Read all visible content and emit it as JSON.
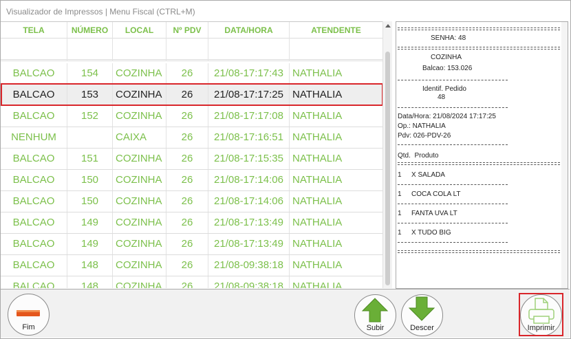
{
  "window": {
    "title": "Visualizador de Impressos | Menu Fiscal (CTRL+M)"
  },
  "grid": {
    "columns": [
      "TELA",
      "NÚMERO",
      "LOCAL",
      "Nº PDV",
      "DATA/HORA",
      "ATENDENTE"
    ],
    "rows": [
      [
        "BALCAO",
        "154",
        "COZINHA",
        "26",
        "21/08-17:17:43",
        "NATHALIA"
      ],
      [
        "BALCAO",
        "153",
        "COZINHA",
        "26",
        "21/08-17:17:25",
        "NATHALIA"
      ],
      [
        "BALCAO",
        "152",
        "COZINHA",
        "26",
        "21/08-17:17:08",
        "NATHALIA"
      ],
      [
        "NENHUM",
        "",
        "CAIXA",
        "26",
        "21/08-17:16:51",
        "NATHALIA"
      ],
      [
        "BALCAO",
        "151",
        "COZINHA",
        "26",
        "21/08-17:15:35",
        "NATHALIA"
      ],
      [
        "BALCAO",
        "150",
        "COZINHA",
        "26",
        "21/08-17:14:06",
        "NATHALIA"
      ],
      [
        "BALCAO",
        "150",
        "COZINHA",
        "26",
        "21/08-17:14:06",
        "NATHALIA"
      ],
      [
        "BALCAO",
        "149",
        "COZINHA",
        "26",
        "21/08-17:13:49",
        "NATHALIA"
      ],
      [
        "BALCAO",
        "149",
        "COZINHA",
        "26",
        "21/08-17:13:49",
        "NATHALIA"
      ],
      [
        "BALCAO",
        "148",
        "COZINHA",
        "26",
        "21/08-09:38:18",
        "NATHALIA"
      ],
      [
        "BALCAO",
        "148",
        "COZINHA",
        "26",
        "21/08-09:38:18",
        "NATHALIA"
      ]
    ],
    "selected_row": 1
  },
  "receipt": {
    "senha": "SENHA: 48",
    "local": "COZINHA",
    "balcao": "Balcao: 153.026",
    "identif_label": "Identif. Pedido",
    "identif_value": "48",
    "datahora": "Data/Hora: 21/08/2024 17:17:25",
    "operador": "Op.: NATHALIA",
    "pdv": "Pdv: 026-PDV-26",
    "items_header": "Qtd.  Produto",
    "items": [
      {
        "qty": "1",
        "name": "X SALADA"
      },
      {
        "qty": "1",
        "name": "COCA COLA LT"
      },
      {
        "qty": "1",
        "name": "FANTA UVA LT"
      },
      {
        "qty": "1",
        "name": "X TUDO BIG"
      }
    ]
  },
  "buttons": {
    "fim": "Fim",
    "subir": "Subir",
    "descer": "Descer",
    "imprimir": "Imprimir"
  },
  "colors": {
    "accent_green": "#7cc04b",
    "highlight_red": "#d9252a",
    "fim_orange": "#e4561c"
  },
  "icons": {
    "fim": "minus-bar-icon",
    "subir": "arrow-up-icon",
    "descer": "arrow-down-icon",
    "imprimir": "printer-icon"
  }
}
